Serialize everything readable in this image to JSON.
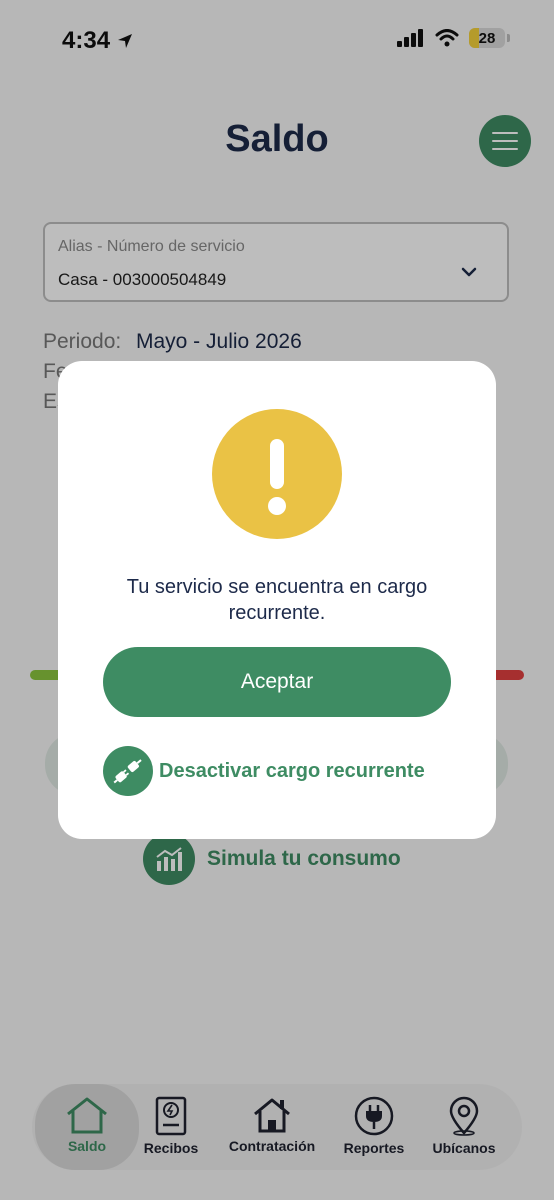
{
  "status_bar": {
    "time": "4:34",
    "battery": "28"
  },
  "header": {
    "title": "Saldo"
  },
  "service_selector": {
    "label": "Alias - Número de servicio",
    "value": "Casa - 003000504849"
  },
  "period": {
    "label": "Periodo:",
    "value": "Mayo - Julio 2026",
    "partial_label_2": "Fe",
    "partial_label_3": "Es"
  },
  "simulate": {
    "label": "Simula tu consumo"
  },
  "modal": {
    "message": "Tu servicio se encuentra en cargo recurrente.",
    "accept_label": "Aceptar",
    "deactivate_label": "Desactivar cargo recurrente"
  },
  "bottom_nav": {
    "items": [
      {
        "label": "Saldo",
        "icon": "home-icon",
        "active": true
      },
      {
        "label": "Recibos",
        "icon": "receipt-icon"
      },
      {
        "label": "Contratación",
        "icon": "house-icon"
      },
      {
        "label": "Reportes",
        "icon": "plug-icon"
      },
      {
        "label": "Ubícanos",
        "icon": "location-pin-icon"
      }
    ]
  },
  "colors": {
    "brand_green": "#3e8c63",
    "warning_yellow": "#eac245",
    "title_navy": "#1d2a4a"
  }
}
